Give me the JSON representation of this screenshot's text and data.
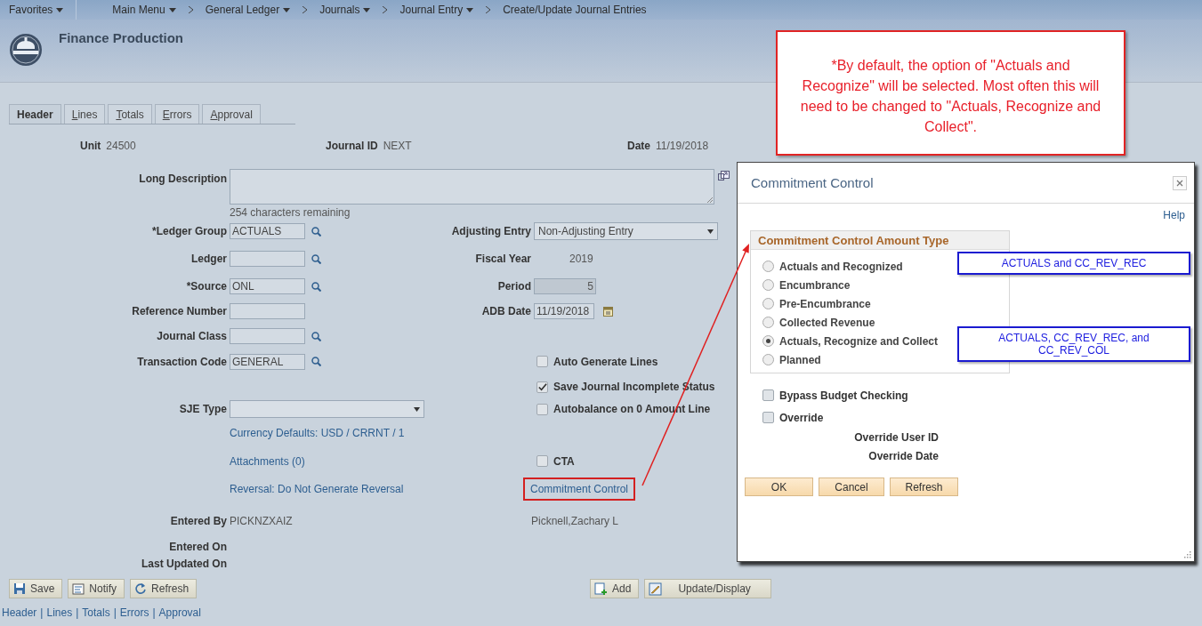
{
  "nav": {
    "favorites": "Favorites",
    "crumbs": [
      {
        "label": "Main Menu",
        "dropdown": true
      },
      {
        "label": "General Ledger",
        "dropdown": true
      },
      {
        "label": "Journals",
        "dropdown": true
      },
      {
        "label": "Journal Entry",
        "dropdown": true
      },
      {
        "label": "Create/Update Journal Entries",
        "dropdown": false
      }
    ]
  },
  "app_title": "Finance Production",
  "tabs": [
    {
      "label": "Header",
      "selected": true,
      "access_key": false
    },
    {
      "label": "Lines",
      "selected": false,
      "access_key": true
    },
    {
      "label": "Totals",
      "selected": false,
      "access_key": true
    },
    {
      "label": "Errors",
      "selected": false,
      "access_key": true
    },
    {
      "label": "Approval",
      "selected": false,
      "access_key": true
    }
  ],
  "summary": [
    {
      "label": "Unit",
      "value": "24500"
    },
    {
      "label": "Journal ID",
      "value": "NEXT"
    },
    {
      "label": "Date",
      "value": "11/19/2018"
    }
  ],
  "long_description": {
    "label": "Long Description",
    "counter": "254 characters remaining"
  },
  "rows": [
    {
      "left": {
        "kind": "lookup",
        "label": "*Ledger Group",
        "value": "ACTUALS"
      },
      "right": {
        "kind": "select",
        "label": "Adjusting Entry",
        "value": "Non-Adjusting Entry"
      }
    },
    {
      "left": {
        "kind": "lookup",
        "label": "Ledger"
      },
      "right": {
        "kind": "value",
        "label": "Fiscal Year",
        "value": "2019"
      }
    },
    {
      "left": {
        "kind": "lookup",
        "label": "*Source",
        "value": "ONL"
      },
      "right": {
        "kind": "input",
        "label": "Period",
        "value": "5",
        "disabled": true
      }
    },
    {
      "left": {
        "kind": "input",
        "label": "Reference Number"
      },
      "right": {
        "kind": "date",
        "label": "ADB Date",
        "value": "11/19/2018"
      }
    },
    {
      "left": {
        "kind": "lookup",
        "label": "Journal Class"
      }
    },
    {
      "left": {
        "kind": "lookup",
        "label": "Transaction Code",
        "value": "GENERAL"
      },
      "right": {
        "kind": "checkbox",
        "label": "Auto Generate Lines",
        "checked": false
      }
    },
    {
      "right": {
        "kind": "checkbox",
        "label": "Save Journal Incomplete Status",
        "checked": true
      }
    },
    {
      "left": {
        "kind": "select",
        "label": "SJE Type"
      },
      "right": {
        "kind": "checkbox",
        "label": "Autobalance on 0 Amount Line",
        "checked": false
      }
    },
    {
      "left": {
        "kind": "link",
        "text": "Currency Defaults: USD / CRRNT / 1"
      }
    },
    {
      "left": {
        "kind": "link",
        "text": "Attachments (0)"
      },
      "right": {
        "kind": "checkbox",
        "label": "CTA",
        "checked": false
      }
    },
    {
      "left": {
        "kind": "link",
        "text": "Reversal: Do Not Generate Reversal"
      },
      "right": {
        "kind": "link",
        "text": "Commitment Control",
        "highlighted": true
      }
    },
    {
      "left": {
        "kind": "value",
        "label": "Entered By",
        "value": "PICKNZXAIZ"
      },
      "right": {
        "kind": "text",
        "text": "Picknell,Zachary L"
      }
    },
    {
      "left": {
        "kind": "label",
        "label": "Entered On"
      }
    },
    {
      "left": {
        "kind": "label",
        "label": "Last Updated On"
      }
    }
  ],
  "toolbar_left": [
    {
      "label": "Save",
      "kind": "save"
    },
    {
      "label": "Notify",
      "kind": "notify"
    },
    {
      "label": "Refresh",
      "kind": "refresh"
    }
  ],
  "toolbar_right": [
    {
      "label": "Add",
      "kind": "add"
    },
    {
      "label": "Update/Display",
      "kind": "update"
    }
  ],
  "footer_links": {
    "separator": "|",
    "links": [
      "Header",
      "Lines",
      "Totals",
      "Errors",
      "Approval"
    ]
  },
  "callout": {
    "text": "*By default, the option of \"Actuals and Recognize\" will be selected. Most often this will need to be changed to \"Actuals, Recognize and Collect\"."
  },
  "dialog": {
    "title": "Commitment Control",
    "help": "Help",
    "group_title": "Commitment Control Amount Type",
    "options": [
      {
        "label": "Actuals and Recognized",
        "selected": false,
        "note": "ACTUALS and CC_REV_REC"
      },
      {
        "label": "Encumbrance",
        "selected": false
      },
      {
        "label": "Pre-Encumbrance",
        "selected": false
      },
      {
        "label": "Collected Revenue",
        "selected": false
      },
      {
        "label": "Actuals, Recognize and Collect",
        "selected": true,
        "note": "ACTUALS, CC_REV_REC, and CC_REV_COL"
      },
      {
        "label": "Planned",
        "selected": false
      }
    ],
    "checkboxes": [
      {
        "label": "Bypass Budget Checking",
        "checked": false
      },
      {
        "label": "Override",
        "checked": false
      }
    ],
    "info_labels": [
      "Override User ID",
      "Override Date"
    ],
    "buttons": [
      "OK",
      "Cancel",
      "Refresh"
    ]
  }
}
